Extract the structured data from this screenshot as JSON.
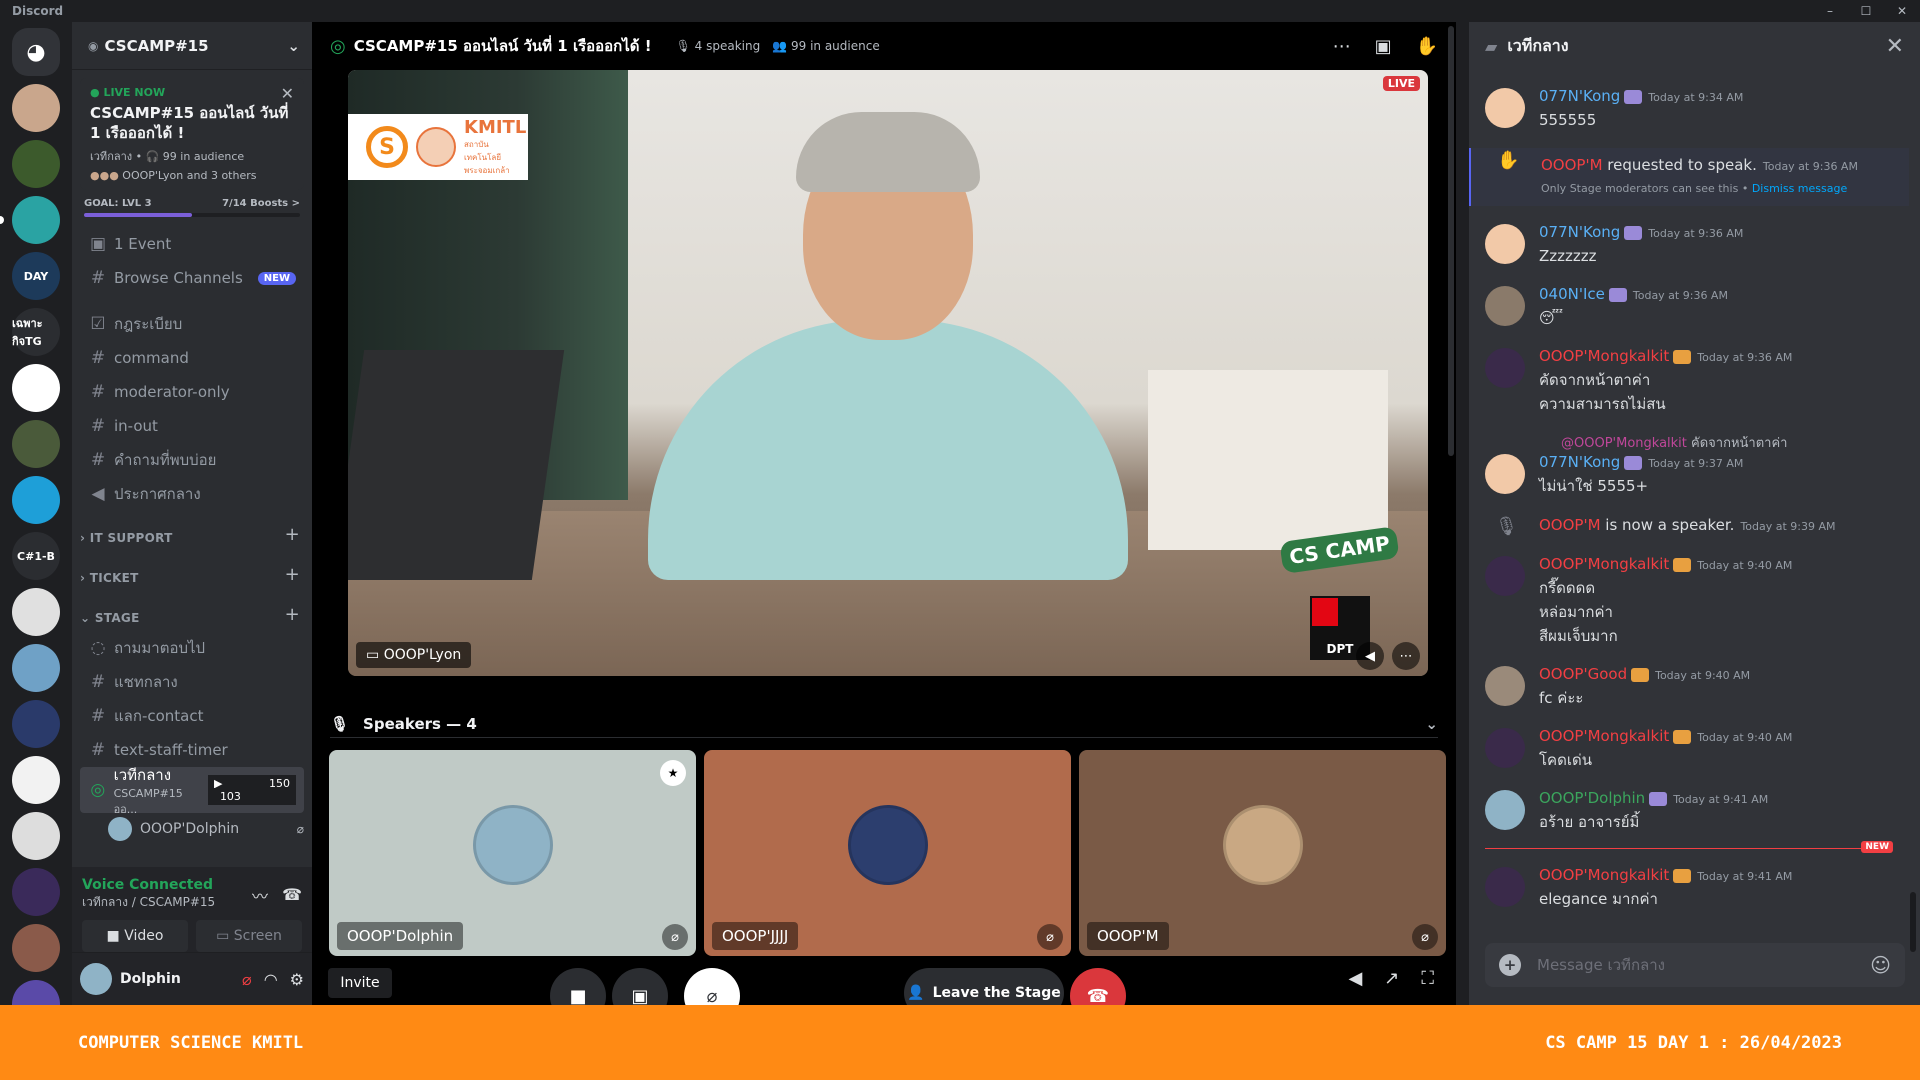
{
  "app": {
    "name": "Discord",
    "window_controls": [
      "–",
      "☐",
      "✕"
    ]
  },
  "colors": {
    "accent": "#5865f2",
    "live_green": "#23a55a",
    "danger": "#da373c",
    "banner_orange": "#ff8a14"
  },
  "rail": {
    "servers": [
      {
        "label": "",
        "color": "#313338",
        "icon": "discord-logo-icon"
      },
      {
        "label": "",
        "color": "#c9a68c"
      },
      {
        "label": "",
        "color": "#3c5a2c"
      },
      {
        "label": "",
        "color": "#2aa3a3"
      },
      {
        "label": "DAY",
        "color": "#1d3a5a"
      },
      {
        "label": "เฉพาะกิจTG",
        "color": "#2b2d31"
      },
      {
        "label": "",
        "color": "#ffffff"
      },
      {
        "label": "",
        "color": "#4a5a3a"
      },
      {
        "label": "",
        "color": "#1e9fd8"
      },
      {
        "label": "C#1-B",
        "color": "#2b2d31"
      },
      {
        "label": "",
        "color": "#e0e0e0"
      },
      {
        "label": "",
        "color": "#6fa1c6"
      },
      {
        "label": "",
        "color": "#2a3a6a"
      },
      {
        "label": "",
        "color": "#f2f2f2"
      },
      {
        "label": "",
        "color": "#dddddd"
      },
      {
        "label": "",
        "color": "#3a2a5a"
      },
      {
        "label": "",
        "color": "#8a5a4a"
      },
      {
        "label": "",
        "color": "#5a4aa8"
      }
    ]
  },
  "sidebar": {
    "server_name": "CSCAMP#15",
    "live": {
      "status": "LIVE NOW",
      "title": "CSCAMP#15 ออนไลน์ วันที่ 1 เรือออกได้ !",
      "meta": "เวทีกลาง • 🎧 99 in audience",
      "speakers": "OOOP'Lyon and 3 others"
    },
    "goal": {
      "label": "GOAL: LVL 3",
      "boosts": "7/14 Boosts >",
      "progress": 0.5
    },
    "top_items": [
      {
        "icon": "calendar-icon",
        "glyph": "▣",
        "label": "1 Event"
      },
      {
        "icon": "browse-icon",
        "glyph": "#",
        "label": "Browse Channels",
        "badge": "NEW"
      }
    ],
    "channels": [
      {
        "icon": "checkbox-icon",
        "glyph": "☑",
        "label": "กฎระเบียบ"
      },
      {
        "icon": "hash-icon",
        "glyph": "#",
        "label": "command"
      },
      {
        "icon": "hash-icon",
        "glyph": "#",
        "label": "moderator-only"
      },
      {
        "icon": "hash-icon",
        "glyph": "#",
        "label": "in-out"
      },
      {
        "icon": "hash-icon",
        "glyph": "#",
        "label": "คำถามที่พบบ่อย"
      },
      {
        "icon": "megaphone-icon",
        "glyph": "◀",
        "label": "ประกาศกลาง"
      }
    ],
    "categories": [
      {
        "label": "› IT SUPPORT"
      },
      {
        "label": "› TICKET"
      },
      {
        "label": "⌄ STAGE"
      }
    ],
    "stage_channels": [
      {
        "icon": "forum-icon",
        "glyph": "◌",
        "label": "ถามมาตอบไป"
      },
      {
        "icon": "hash-icon",
        "glyph": "#",
        "label": "แชทกลาง"
      },
      {
        "icon": "hash-icon",
        "glyph": "#",
        "label": "แลก-contact"
      },
      {
        "icon": "hash-icon",
        "glyph": "#",
        "label": "text-staff-timer"
      }
    ],
    "active_channel": {
      "label": "เวทีกลาง",
      "sub": "CSCAMP#15 ออ...",
      "count_a": "103",
      "count_b": "150"
    },
    "voice_user": "OOOP'Dolphin",
    "voice": {
      "status": "Voice Connected",
      "location": "เวทีกลาง / CSCAMP#15",
      "video_label": "Video",
      "screen_label": "Screen"
    },
    "user": {
      "name": "Dolphin"
    }
  },
  "stage": {
    "title": "CSCAMP#15 ออนไลน์ วันที่ 1 เรือออกได้ !",
    "speaking": "4 speaking",
    "audience": "99 in audience",
    "video": {
      "live_label": "LIVE",
      "streamer": "OOOP'Lyon",
      "logo_text": "KMITL",
      "logo_sub": "สถาบันเทคโนโลยี พระจอมเกล้า",
      "overlay_logo": "CS CAMP",
      "dpt_label": "DPT"
    },
    "speakers_label": "Speakers — 4",
    "tiles": [
      {
        "name": "OOOP'Dolphin",
        "bg": "#c0cac6",
        "pic": "#8fb3c6",
        "moderator": true
      },
      {
        "name": "OOOP'JJJJ",
        "bg": "#b16b4c",
        "pic": "#2c3e6e",
        "moderator": false
      },
      {
        "name": "OOOP'M",
        "bg": "#7a5a46",
        "pic": "#c9a883",
        "moderator": false
      }
    ],
    "controls": {
      "invite": "Invite",
      "leave": "Leave the Stage"
    }
  },
  "chat": {
    "channel": "เวทีกลาง",
    "placeholder": "Message เวทีกลาง",
    "new_label": "NEW",
    "messages": [
      {
        "kind": "msg",
        "author": "077N'Kong",
        "color": "#5ab0f5",
        "av": "#f2c9a8",
        "tag": "#9a8ad8",
        "time": "Today at 9:34 AM",
        "lines": [
          "555555"
        ]
      },
      {
        "kind": "sys",
        "icon": "hand-icon",
        "glyph": "✋",
        "actor": "OOOP'M",
        "color": "#f23f43",
        "text": " requested to speak.",
        "time": "Today at 9:36 AM",
        "note": "Only Stage moderators can see this • ",
        "link": "Dismiss message"
      },
      {
        "kind": "msg",
        "author": "077N'Kong",
        "color": "#5ab0f5",
        "av": "#f2c9a8",
        "tag": "#9a8ad8",
        "time": "Today at 9:36 AM",
        "lines": [
          "Zzzzzzz"
        ]
      },
      {
        "kind": "msg",
        "author": "040N'Ice",
        "color": "#5ab0f5",
        "av": "#8a7a6a",
        "tag": "#9a8ad8",
        "time": "Today at 9:36 AM",
        "lines": [],
        "emoji": "😴"
      },
      {
        "kind": "msg",
        "author": "OOOP'Mongkalkit",
        "color": "#f23f43",
        "av": "#3a2a4a",
        "tag": "#e8a040",
        "time": "Today at 9:36 AM",
        "lines": [
          "คัดจากหน้าตาค่า",
          "ความสามารถไม่สน"
        ]
      },
      {
        "kind": "reply",
        "mention": "@OOOP'Mongkalkit",
        "text": " คัดจากหน้าตาค่า"
      },
      {
        "kind": "msg",
        "author": "077N'Kong",
        "color": "#5ab0f5",
        "av": "#f2c9a8",
        "tag": "#9a8ad8",
        "time": "Today at 9:37 AM",
        "lines": [
          "ไม่น่าใช่ 5555+"
        ]
      },
      {
        "kind": "sys",
        "icon": "mic-up-icon",
        "glyph": "🎙",
        "actor": "OOOP'M",
        "color": "#f23f43",
        "text": " is now a speaker.",
        "time": "Today at 9:39 AM"
      },
      {
        "kind": "msg",
        "author": "OOOP'Mongkalkit",
        "color": "#f23f43",
        "av": "#3a2a4a",
        "tag": "#e8a040",
        "time": "Today at 9:40 AM",
        "lines": [
          "กรี๊ดดดด",
          "หล่อมากค่า",
          "สีผมเจ็บมาก"
        ]
      },
      {
        "kind": "msg",
        "author": "OOOP'Good",
        "color": "#f23f43",
        "av": "#9a8a7a",
        "tag": "#e8a040",
        "time": "Today at 9:40 AM",
        "lines": [
          "fc ค่ะะ"
        ]
      },
      {
        "kind": "msg",
        "author": "OOOP'Mongkalkit",
        "color": "#f23f43",
        "av": "#3a2a4a",
        "tag": "#e8a040",
        "time": "Today at 9:40 AM",
        "lines": [
          "โคดเด่น"
        ]
      },
      {
        "kind": "msg",
        "author": "OOOP'Dolphin",
        "color": "#3ba55d",
        "av": "#8fb3c6",
        "tag": "#9a8ad8",
        "time": "Today at 9:41 AM",
        "lines": [
          "อร้าย อาจารย์มิ้"
        ]
      },
      {
        "kind": "newdiv"
      },
      {
        "kind": "msg",
        "author": "OOOP'Mongkalkit",
        "color": "#f23f43",
        "av": "#3a2a4a",
        "tag": "#e8a040",
        "time": "Today at 9:41 AM",
        "lines": [
          "elegance มากค่า"
        ]
      }
    ]
  },
  "banner": {
    "left": "COMPUTER SCIENCE KMITL",
    "right": "CS CAMP 15 DAY 1 : 26/04/2023"
  }
}
